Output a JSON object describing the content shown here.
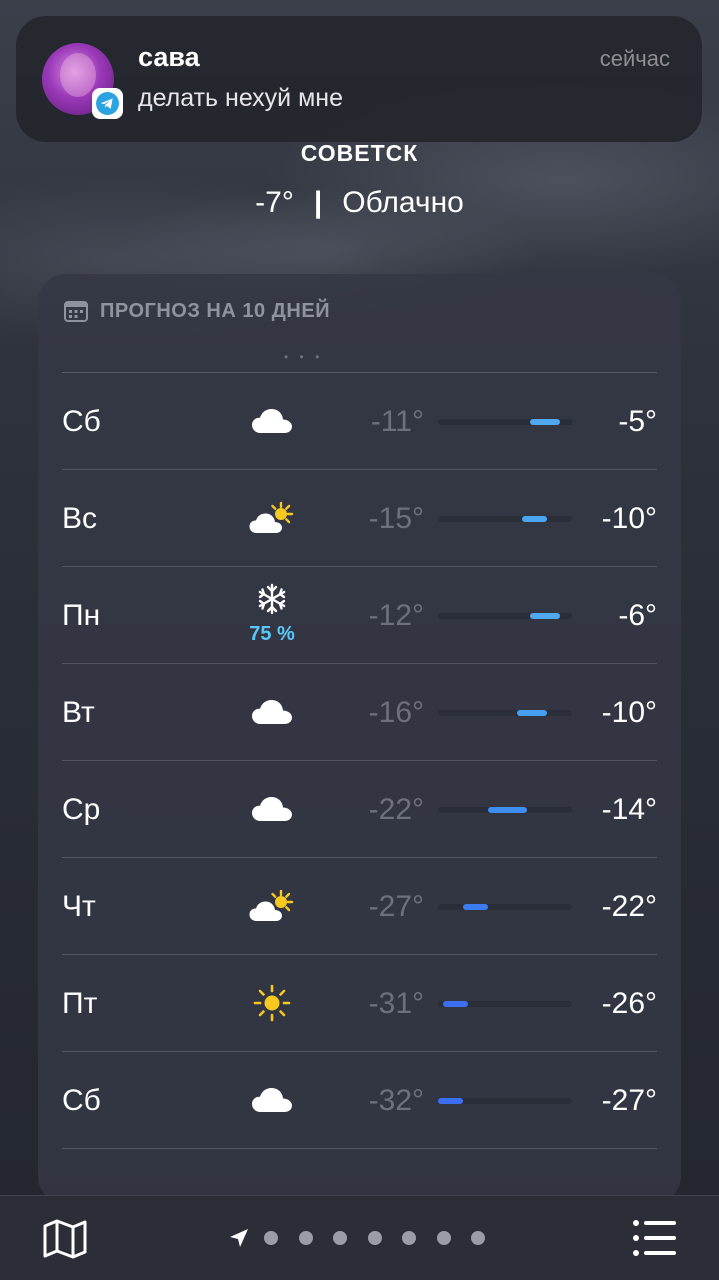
{
  "notification": {
    "sender": "сава",
    "time": "сейчас",
    "message": "делать нехуй мне",
    "app_badge_icon": "telegram-icon"
  },
  "location": {
    "city": "СОВЕТСК",
    "temperature": "-7°",
    "separator": "|",
    "condition": "Облачно"
  },
  "forecast": {
    "header_label": "ПРОГНОЗ НА 10 ДНЕЙ",
    "header_icon": "calendar-icon",
    "range_min": -32,
    "range_max": -5,
    "days": [
      {
        "day": "Сб",
        "icon": "cloud-icon",
        "precip": "",
        "low": "-11°",
        "high": "-5°",
        "low_value": -11,
        "high_value": -5,
        "bar_color": "#4fa8f0"
      },
      {
        "day": "Вс",
        "icon": "partly-sunny-icon",
        "precip": "",
        "low": "-15°",
        "high": "-10°",
        "low_value": -15,
        "high_value": -10,
        "bar_color": "#4aa5f2"
      },
      {
        "day": "Пн",
        "icon": "snowflake-icon",
        "precip": "75 %",
        "low": "-12°",
        "high": "-6°",
        "low_value": -12,
        "high_value": -6,
        "bar_color": "#4fa8f0"
      },
      {
        "day": "Вт",
        "icon": "cloud-icon",
        "precip": "",
        "low": "-16°",
        "high": "-10°",
        "low_value": -16,
        "high_value": -10,
        "bar_color": "#45a0f2"
      },
      {
        "day": "Ср",
        "icon": "cloud-icon",
        "precip": "",
        "low": "-22°",
        "high": "-14°",
        "low_value": -22,
        "high_value": -14,
        "bar_color": "#3d8ef0"
      },
      {
        "day": "Чт",
        "icon": "partly-sunny-icon",
        "precip": "",
        "low": "-27°",
        "high": "-22°",
        "low_value": -27,
        "high_value": -22,
        "bar_color": "#3b7cf0"
      },
      {
        "day": "Пт",
        "icon": "sun-icon",
        "precip": "",
        "low": "-31°",
        "high": "-26°",
        "low_value": -31,
        "high_value": -26,
        "bar_color": "#3b6ff0"
      },
      {
        "day": "Сб",
        "icon": "cloud-icon",
        "precip": "",
        "low": "-32°",
        "high": "-27°",
        "low_value": -32,
        "high_value": -27,
        "bar_color": "#3b6ef0"
      }
    ]
  },
  "toolbar": {
    "map_icon": "map-icon",
    "location_icon": "location-arrow-icon",
    "page_count": 7,
    "list_icon": "list-icon"
  }
}
